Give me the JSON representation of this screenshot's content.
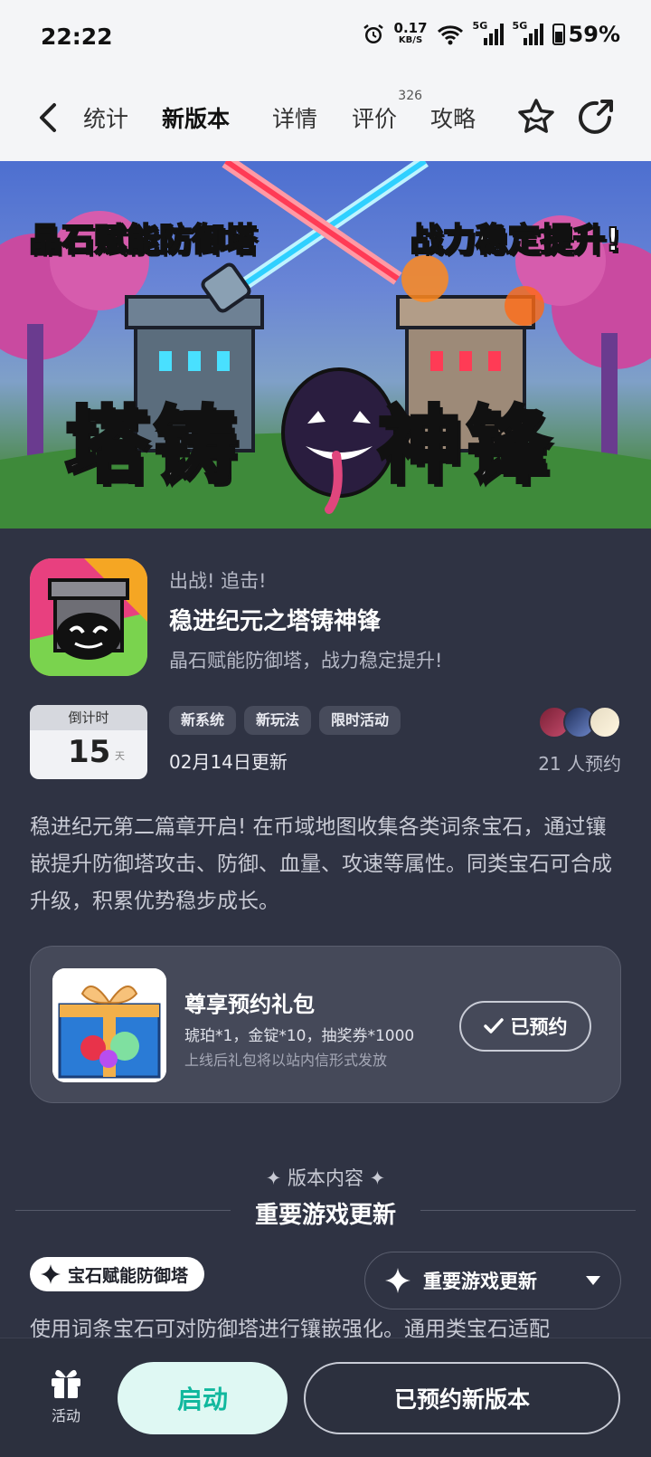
{
  "status_bar": {
    "time": "22:22",
    "net_speed_value": "0.17",
    "net_speed_unit": "KB/S",
    "signal_1_label": "5G",
    "signal_2_label": "5G",
    "battery": "59%",
    "icons": [
      "alarm-icon",
      "wifi-icon",
      "signal-icon",
      "battery-icon"
    ]
  },
  "nav": {
    "tabs": [
      {
        "label": "统计",
        "active": false
      },
      {
        "label": "新版本",
        "active": true
      },
      {
        "label": "详情",
        "active": false
      },
      {
        "label": "评价",
        "active": false,
        "badge": "326"
      },
      {
        "label": "攻略",
        "active": false
      }
    ],
    "accent": "#14d1b6"
  },
  "banner": {
    "left_text": "晶石赋能防御塔",
    "right_text": "战力稳定提升!",
    "main_text_1": "塔铸",
    "main_text_2": "神锋"
  },
  "app": {
    "subtitle": "出战! 追击!",
    "name": "稳进纪元之塔铸神锋",
    "tagline": "晶石赋能防御塔，战力稳定提升!"
  },
  "countdown": {
    "label": "倒计时",
    "days": "15",
    "unit": "天"
  },
  "tags": [
    "新系统",
    "新玩法",
    "限时活动"
  ],
  "update_date": "02月14日更新",
  "reserve_count": "21 人预约",
  "description": "稳进纪元第二篇章开启! 在币域地图收集各类词条宝石，通过镶嵌提升防御塔攻击、防御、血量、攻速等属性。同类宝石可合成升级，积累优势稳步成长。",
  "gift": {
    "title": "尊享预约礼包",
    "items": "琥珀*1，金锭*10，抽奖券*1000",
    "note": "上线后礼包将以站内信形式发放",
    "button_label": "已预约"
  },
  "version_content": {
    "label": "✦ 版本内容 ✦",
    "title": "重要游戏更新",
    "feature_chip": "宝石赋能防御塔",
    "dropdown_label": "重要游戏更新",
    "feature_text": "使用词条宝石可对防御塔进行镶嵌强化。通用类宝石适配"
  },
  "bottom_bar": {
    "activity_label": "活动",
    "launch_label": "启动",
    "reserved_version_label": "已预约新版本"
  }
}
